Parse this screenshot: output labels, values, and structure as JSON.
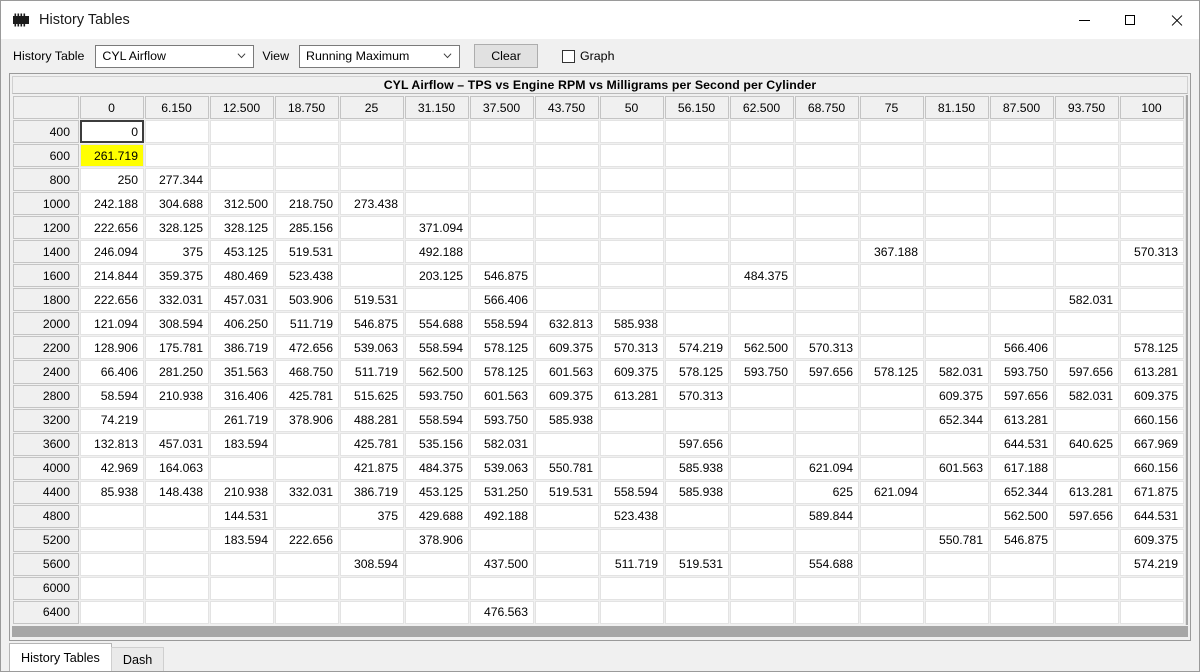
{
  "window": {
    "title": "History Tables",
    "icon": "chip-icon",
    "controls": {
      "minimize": "minimize-icon",
      "maximize": "maximize-icon",
      "close": "close-icon"
    }
  },
  "toolbar": {
    "history_table_label": "History Table",
    "history_table_value": "CYL Airflow",
    "view_label": "View",
    "view_value": "Running Maximum",
    "clear_label": "Clear",
    "graph_label": "Graph",
    "graph_checked": false
  },
  "grid": {
    "title": "CYL Airflow – TPS vs Engine RPM vs Milligrams per Second per Cylinder",
    "corner_label": "",
    "columns": [
      "0",
      "6.150",
      "12.500",
      "18.750",
      "25",
      "31.150",
      "37.500",
      "43.750",
      "50",
      "56.150",
      "62.500",
      "68.750",
      "75",
      "81.150",
      "87.500",
      "93.750",
      "100"
    ],
    "rows": [
      "400",
      "600",
      "800",
      "1000",
      "1200",
      "1400",
      "1600",
      "1800",
      "2000",
      "2200",
      "2400",
      "2800",
      "3200",
      "3600",
      "4000",
      "4400",
      "4800",
      "5200",
      "5600",
      "6000",
      "6400"
    ],
    "selected_cell": {
      "row": 0,
      "col": 0
    },
    "highlight_cell": {
      "row": 1,
      "col": 0,
      "color": "#ffff00"
    },
    "values": [
      [
        "0",
        "",
        "",
        "",
        "",
        "",
        "",
        "",
        "",
        "",
        "",
        "",
        "",
        "",
        "",
        "",
        ""
      ],
      [
        "261.719",
        "",
        "",
        "",
        "",
        "",
        "",
        "",
        "",
        "",
        "",
        "",
        "",
        "",
        "",
        "",
        ""
      ],
      [
        "250",
        "277.344",
        "",
        "",
        "",
        "",
        "",
        "",
        "",
        "",
        "",
        "",
        "",
        "",
        "",
        "",
        ""
      ],
      [
        "242.188",
        "304.688",
        "312.500",
        "218.750",
        "273.438",
        "",
        "",
        "",
        "",
        "",
        "",
        "",
        "",
        "",
        "",
        "",
        ""
      ],
      [
        "222.656",
        "328.125",
        "328.125",
        "285.156",
        "",
        "371.094",
        "",
        "",
        "",
        "",
        "",
        "",
        "",
        "",
        "",
        "",
        ""
      ],
      [
        "246.094",
        "375",
        "453.125",
        "519.531",
        "",
        "492.188",
        "",
        "",
        "",
        "",
        "",
        "",
        "367.188",
        "",
        "",
        "",
        "570.313"
      ],
      [
        "214.844",
        "359.375",
        "480.469",
        "523.438",
        "",
        "203.125",
        "546.875",
        "",
        "",
        "",
        "484.375",
        "",
        "",
        "",
        "",
        "",
        ""
      ],
      [
        "222.656",
        "332.031",
        "457.031",
        "503.906",
        "519.531",
        "",
        "566.406",
        "",
        "",
        "",
        "",
        "",
        "",
        "",
        "",
        "582.031",
        ""
      ],
      [
        "121.094",
        "308.594",
        "406.250",
        "511.719",
        "546.875",
        "554.688",
        "558.594",
        "632.813",
        "585.938",
        "",
        "",
        "",
        "",
        "",
        "",
        "",
        ""
      ],
      [
        "128.906",
        "175.781",
        "386.719",
        "472.656",
        "539.063",
        "558.594",
        "578.125",
        "609.375",
        "570.313",
        "574.219",
        "562.500",
        "570.313",
        "",
        "",
        "566.406",
        "",
        "578.125"
      ],
      [
        "66.406",
        "281.250",
        "351.563",
        "468.750",
        "511.719",
        "562.500",
        "578.125",
        "601.563",
        "609.375",
        "578.125",
        "593.750",
        "597.656",
        "578.125",
        "582.031",
        "593.750",
        "597.656",
        "613.281"
      ],
      [
        "58.594",
        "210.938",
        "316.406",
        "425.781",
        "515.625",
        "593.750",
        "601.563",
        "609.375",
        "613.281",
        "570.313",
        "",
        "",
        "",
        "609.375",
        "597.656",
        "582.031",
        "609.375"
      ],
      [
        "74.219",
        "",
        "261.719",
        "378.906",
        "488.281",
        "558.594",
        "593.750",
        "585.938",
        "",
        "",
        "",
        "",
        "",
        "652.344",
        "613.281",
        "",
        "660.156"
      ],
      [
        "132.813",
        "457.031",
        "183.594",
        "",
        "425.781",
        "535.156",
        "582.031",
        "",
        "",
        "597.656",
        "",
        "",
        "",
        "",
        "644.531",
        "640.625",
        "667.969"
      ],
      [
        "42.969",
        "164.063",
        "",
        "",
        "421.875",
        "484.375",
        "539.063",
        "550.781",
        "",
        "585.938",
        "",
        "621.094",
        "",
        "601.563",
        "617.188",
        "",
        "660.156"
      ],
      [
        "85.938",
        "148.438",
        "210.938",
        "332.031",
        "386.719",
        "453.125",
        "531.250",
        "519.531",
        "558.594",
        "585.938",
        "",
        "625",
        "621.094",
        "",
        "652.344",
        "613.281",
        "671.875"
      ],
      [
        "",
        "",
        "144.531",
        "",
        "375",
        "429.688",
        "492.188",
        "",
        "523.438",
        "",
        "",
        "589.844",
        "",
        "",
        "562.500",
        "597.656",
        "644.531"
      ],
      [
        "",
        "",
        "183.594",
        "222.656",
        "",
        "378.906",
        "",
        "",
        "",
        "",
        "",
        "",
        "",
        "550.781",
        "546.875",
        "",
        "609.375"
      ],
      [
        "",
        "",
        "",
        "",
        "308.594",
        "",
        "437.500",
        "",
        "511.719",
        "519.531",
        "",
        "554.688",
        "",
        "",
        "",
        "",
        "574.219"
      ],
      [
        "",
        "",
        "",
        "",
        "",
        "",
        "",
        "",
        "",
        "",
        "",
        "",
        "",
        "",
        "",
        "",
        ""
      ],
      [
        "",
        "",
        "",
        "",
        "",
        "",
        "476.563",
        "",
        "",
        "",
        "",
        "",
        "",
        "",
        "",
        "",
        ""
      ]
    ]
  },
  "tabs": [
    {
      "label": "History Tables",
      "active": true
    },
    {
      "label": "Dash",
      "active": false
    }
  ]
}
